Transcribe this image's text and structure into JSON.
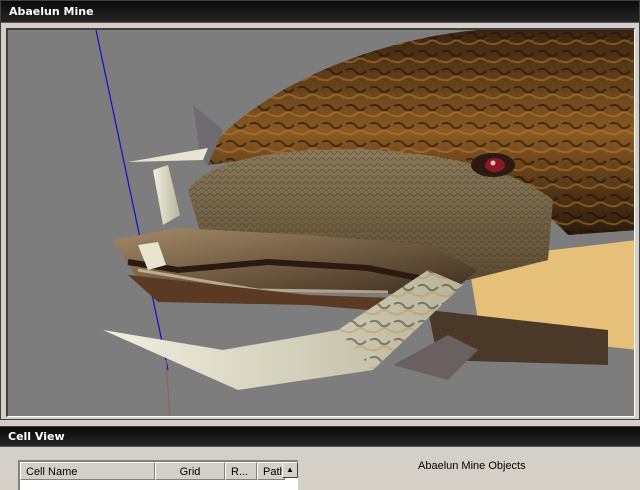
{
  "render_window": {
    "title": "Abaelun Mine"
  },
  "cell_view": {
    "title": "Cell View",
    "columns": [
      "Cell Name",
      "Grid",
      "R...",
      "Path"
    ],
    "objects_label": "Abaelun Mine Objects"
  }
}
